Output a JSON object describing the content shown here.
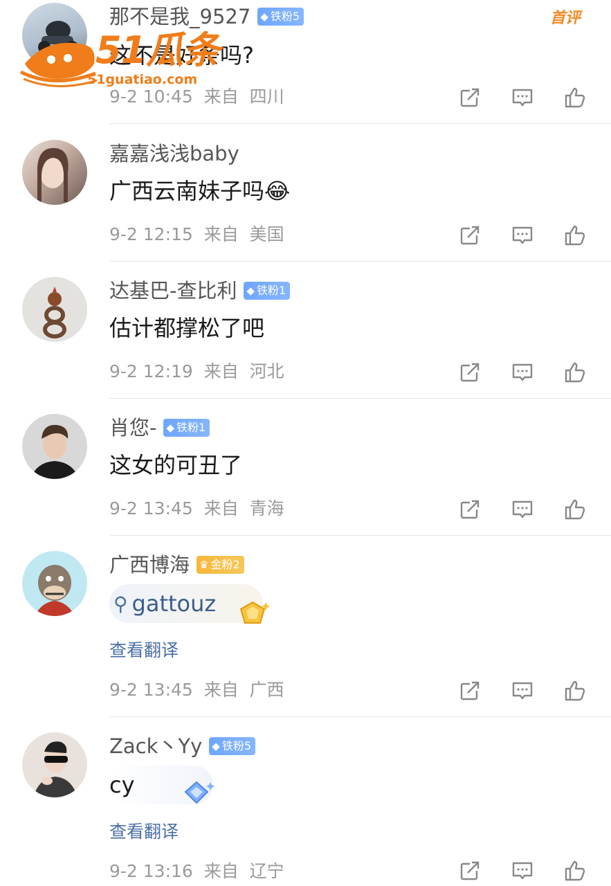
{
  "first_tag": "首评",
  "watermark": {
    "brand": "51瓜条",
    "site": "51guatiao.com"
  },
  "comments": [
    {
      "username": "那不是我_9527",
      "badge": "铁粉5",
      "badge_type": "iron",
      "text": "这不是好条吗?",
      "time": "9-2 10:45",
      "from": "来自",
      "location": "四川"
    },
    {
      "username": "嘉嘉浅浅baby",
      "text": "广西云南妹子吗😂",
      "time": "9-2 12:15",
      "from": "来自",
      "location": "美国"
    },
    {
      "username": "达基巴-查比利",
      "badge": "铁粉1",
      "badge_type": "iron",
      "text": "估计都撑松了吧",
      "time": "9-2 12:19",
      "from": "来自",
      "location": "河北"
    },
    {
      "username": "肖您-",
      "badge": "铁粉1",
      "badge_type": "iron",
      "text": "这女的可丑了",
      "time": "9-2 13:45",
      "from": "来自",
      "location": "青海"
    },
    {
      "username": "广西博海",
      "badge": "金粉2",
      "badge_type": "gold",
      "search_text": "gattouz",
      "translate": "查看翻译",
      "time": "9-2 13:45",
      "from": "来自",
      "location": "广西"
    },
    {
      "username": "Zack丶Yy",
      "badge": "铁粉5",
      "badge_type": "iron",
      "text": "cy",
      "translate": "查看翻译",
      "time": "9-2 13:16",
      "from": "来自",
      "location": "辽宁"
    }
  ],
  "actions": [
    {
      "name": "share-icon"
    },
    {
      "name": "reply-icon"
    },
    {
      "name": "like-icon"
    }
  ],
  "colors": {
    "badge_iron": "#6ea6ff",
    "badge_gold": "#f7b73c",
    "watermark": "#f07d1a",
    "first_tag": "#f08a24"
  }
}
